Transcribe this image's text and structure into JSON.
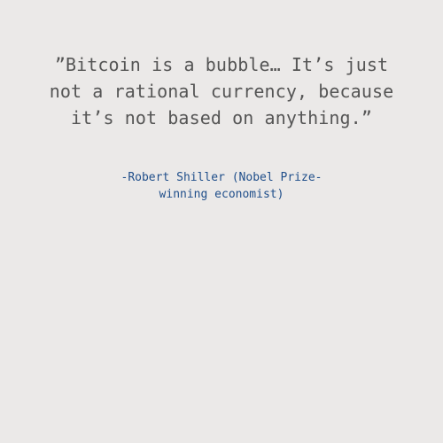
{
  "quote": {
    "lines": [
      "”Bitcoin is a bubble… It’s just",
      "not a rational currency, because",
      "it’s not based on anything.”"
    ]
  },
  "attribution": {
    "lines": [
      "-Robert Shiller (Nobel Prize-",
      "winning economist)"
    ]
  },
  "colors": {
    "background": "#ebe9e8",
    "quote_text": "#555555",
    "attribution_text": "#1f4e8a"
  }
}
